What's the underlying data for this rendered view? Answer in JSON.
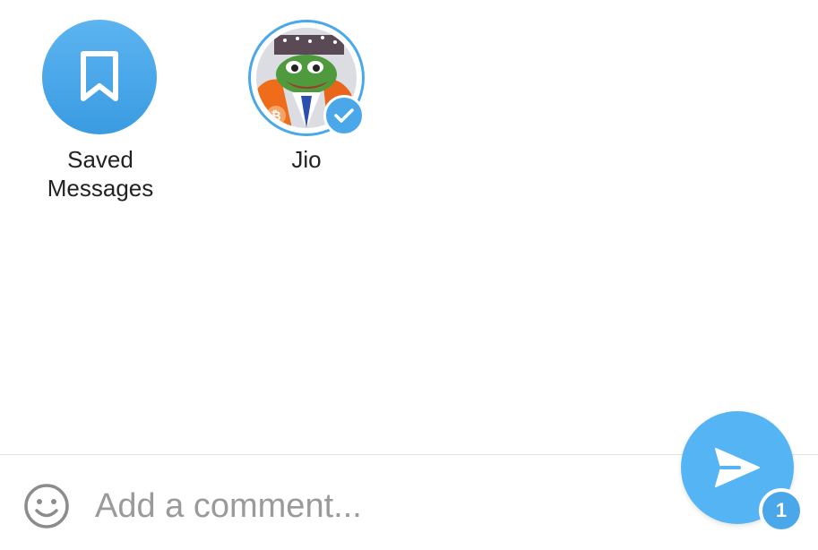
{
  "contacts": [
    {
      "name": "Saved\nMessages",
      "icon": "bookmark-icon",
      "selected": false
    },
    {
      "name": "Jio",
      "icon": "frog-avatar",
      "selected": true
    }
  ],
  "comment": {
    "placeholder": "Add a comment...",
    "value": ""
  },
  "send": {
    "icon": "send-icon",
    "selected_count": "1"
  },
  "colors": {
    "accent": "#4aa8ea",
    "fab": "#55b4f3",
    "text": "#222222",
    "placeholder": "#9a9a9a"
  }
}
